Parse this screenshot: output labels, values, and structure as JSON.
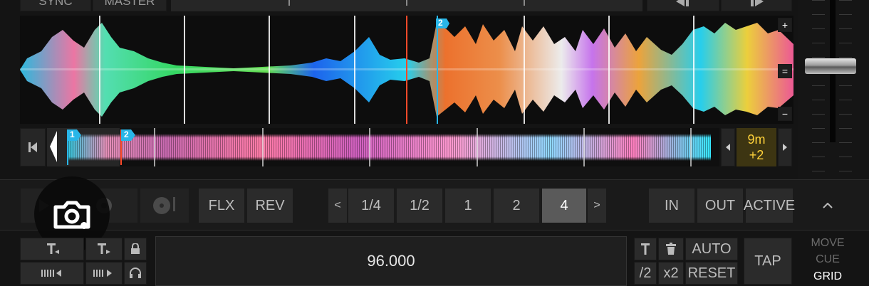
{
  "top": {
    "sync": "SYNC",
    "master": "MASTER"
  },
  "waveform": {
    "cue_marker": "2",
    "zoom_in": "+",
    "zoom_reset": "=",
    "zoom_out": "−"
  },
  "overview": {
    "cue1": "1",
    "cue2": "2",
    "time": "9m",
    "offset": "+2"
  },
  "loop_row": {
    "flx": "FLX",
    "rev": "REV",
    "sizes": [
      "1/4",
      "1/2",
      "1",
      "2",
      "4"
    ],
    "selected_size": "4",
    "prev": "<",
    "next": ">",
    "in": "IN",
    "out": "OUT",
    "active": "ACTIVE",
    "collapse": "^"
  },
  "grid_row": {
    "bpm": "96.000",
    "auto": "AUTO",
    "reset": "RESET",
    "half": "/2",
    "double": "x2",
    "tap": "TAP",
    "move": "MOVE",
    "cue": "CUE",
    "grid": "GRID"
  },
  "colors": {
    "accent_blue": "#29b6e8",
    "playhead_red": "#ff4a2a",
    "timer_yellow": "#ffd23a",
    "timer_bg": "#3d3512"
  }
}
